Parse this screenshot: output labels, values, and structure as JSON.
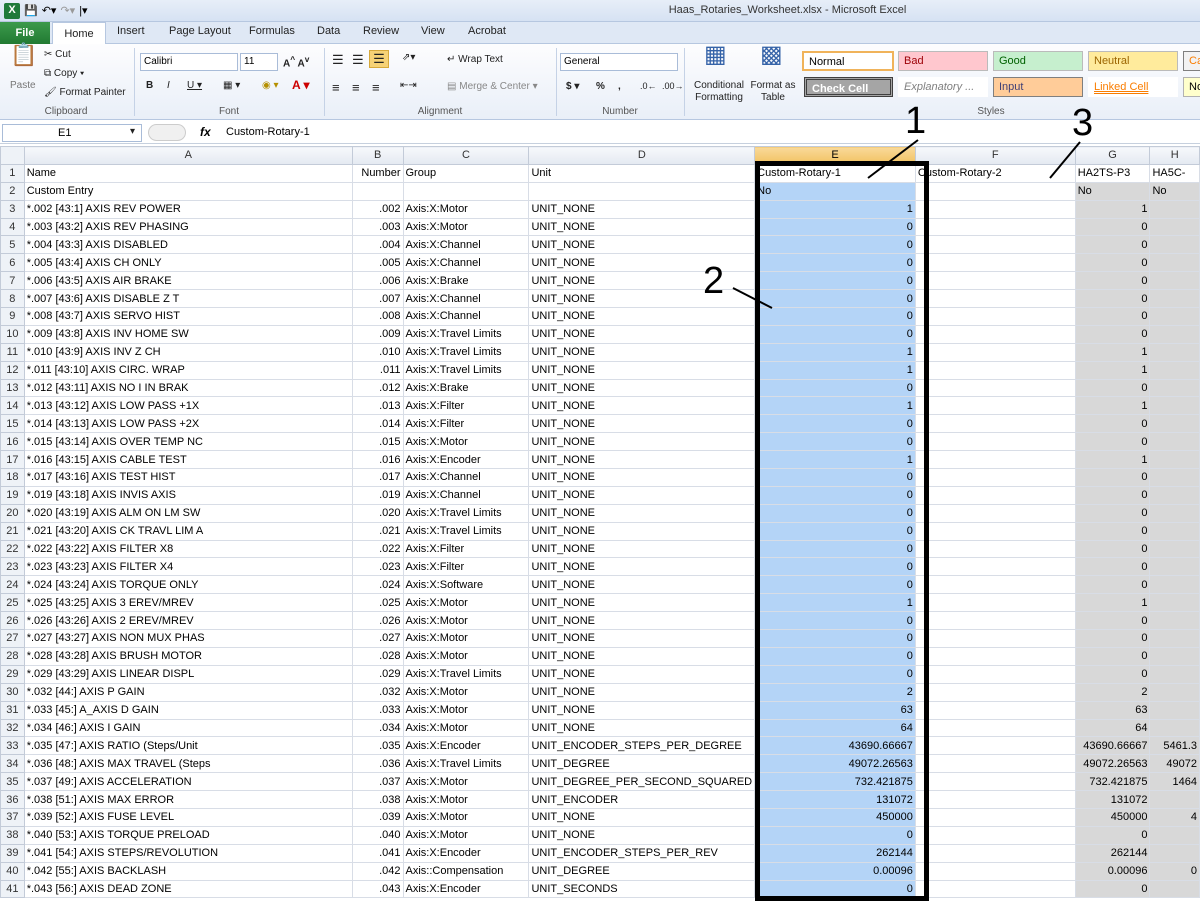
{
  "window": {
    "title": "Haas_Rotaries_Worksheet.xlsx - Microsoft Excel",
    "app_icon": "X"
  },
  "tabs": [
    "File",
    "Home",
    "Insert",
    "Page Layout",
    "Formulas",
    "Data",
    "Review",
    "View",
    "Acrobat"
  ],
  "ribbon": {
    "clipboard": {
      "paste": "Paste",
      "cut": "Cut",
      "copy": "Copy",
      "format_painter": "Format Painter",
      "label": "Clipboard"
    },
    "font": {
      "name": "Calibri",
      "size": "11",
      "label": "Font"
    },
    "alignment": {
      "wrap": "Wrap Text",
      "merge": "Merge & Center",
      "label": "Alignment"
    },
    "number": {
      "format": "General",
      "label": "Number"
    },
    "styles": {
      "conditional": "Conditional Formatting",
      "format_table": "Format as Table",
      "label": "Styles",
      "cells": [
        "Normal",
        "Bad",
        "Good",
        "Neutral",
        "Ca",
        "Check Cell",
        "Explanatory ...",
        "Input",
        "Linked Cell",
        "No"
      ]
    }
  },
  "formula_bar": {
    "cell": "E1",
    "content": "Custom-Rotary-1"
  },
  "columns": [
    "A",
    "B",
    "C",
    "D",
    "E",
    "F",
    "G",
    "H"
  ],
  "rows": [
    {
      "n": "1",
      "a": "Name",
      "b": "Number",
      "c": "Group",
      "d": "Unit",
      "e": "Custom-Rotary-1",
      "f": "Custom-Rotary-2",
      "g": "HA2TS-P3",
      "h": "HA5C-"
    },
    {
      "n": "2",
      "a": "Custom Entry",
      "b": "",
      "c": "",
      "d": "",
      "e": "No",
      "f": "",
      "g": "No",
      "h": "No"
    },
    {
      "n": "3",
      "a": "*.002 [43:1]  AXIS REV POWER",
      "b": ".002",
      "c": "Axis:X:Motor",
      "d": "UNIT_NONE",
      "e": "1",
      "f": "",
      "g": "1",
      "h": ""
    },
    {
      "n": "4",
      "a": "*.003 [43:2]  AXIS REV PHASING",
      "b": ".003",
      "c": "Axis:X:Motor",
      "d": "UNIT_NONE",
      "e": "0",
      "f": "",
      "g": "0",
      "h": ""
    },
    {
      "n": "5",
      "a": "*.004 [43:3]  AXIS DISABLED",
      "b": ".004",
      "c": "Axis:X:Channel",
      "d": "UNIT_NONE",
      "e": "0",
      "f": "",
      "g": "0",
      "h": ""
    },
    {
      "n": "6",
      "a": "*.005 [43:4]  AXIS CH ONLY",
      "b": ".005",
      "c": "Axis:X:Channel",
      "d": "UNIT_NONE",
      "e": "0",
      "f": "",
      "g": "0",
      "h": ""
    },
    {
      "n": "7",
      "a": "*.006 [43:5]  AXIS AIR BRAKE",
      "b": ".006",
      "c": "Axis:X:Brake",
      "d": "UNIT_NONE",
      "e": "0",
      "f": "",
      "g": "0",
      "h": ""
    },
    {
      "n": "8",
      "a": "*.007 [43:6]  AXIS DISABLE Z T",
      "b": ".007",
      "c": "Axis:X:Channel",
      "d": "UNIT_NONE",
      "e": "0",
      "f": "",
      "g": "0",
      "h": ""
    },
    {
      "n": "9",
      "a": "*.008 [43:7]  AXIS SERVO HIST",
      "b": ".008",
      "c": "Axis:X:Channel",
      "d": "UNIT_NONE",
      "e": "0",
      "f": "",
      "g": "0",
      "h": ""
    },
    {
      "n": "10",
      "a": "*.009 [43:8]  AXIS INV HOME SW",
      "b": ".009",
      "c": "Axis:X:Travel Limits",
      "d": "UNIT_NONE",
      "e": "0",
      "f": "",
      "g": "0",
      "h": ""
    },
    {
      "n": "11",
      "a": "*.010 [43:9]  AXIS INV Z CH",
      "b": ".010",
      "c": "Axis:X:Travel Limits",
      "d": "UNIT_NONE",
      "e": "1",
      "f": "",
      "g": "1",
      "h": ""
    },
    {
      "n": "12",
      "a": "*.011 [43:10]  AXIS CIRC. WRAP",
      "b": ".011",
      "c": "Axis:X:Travel Limits",
      "d": "UNIT_NONE",
      "e": "1",
      "f": "",
      "g": "1",
      "h": ""
    },
    {
      "n": "13",
      "a": "*.012 [43:11]  AXIS NO I IN BRAK",
      "b": ".012",
      "c": "Axis:X:Brake",
      "d": "UNIT_NONE",
      "e": "0",
      "f": "",
      "g": "0",
      "h": ""
    },
    {
      "n": "14",
      "a": "*.013 [43:12]  AXIS LOW PASS +1X",
      "b": ".013",
      "c": "Axis:X:Filter",
      "d": "UNIT_NONE",
      "e": "1",
      "f": "",
      "g": "1",
      "h": ""
    },
    {
      "n": "15",
      "a": "*.014 [43:13]  AXIS LOW PASS +2X",
      "b": ".014",
      "c": "Axis:X:Filter",
      "d": "UNIT_NONE",
      "e": "0",
      "f": "",
      "g": "0",
      "h": ""
    },
    {
      "n": "16",
      "a": "*.015 [43:14]  AXIS OVER TEMP NC",
      "b": ".015",
      "c": "Axis:X:Motor",
      "d": "UNIT_NONE",
      "e": "0",
      "f": "",
      "g": "0",
      "h": ""
    },
    {
      "n": "17",
      "a": "*.016 [43:15]  AXIS CABLE TEST",
      "b": ".016",
      "c": "Axis:X:Encoder",
      "d": "UNIT_NONE",
      "e": "1",
      "f": "",
      "g": "1",
      "h": ""
    },
    {
      "n": "18",
      "a": "*.017 [43:16]  AXIS TEST HIST",
      "b": ".017",
      "c": "Axis:X:Channel",
      "d": "UNIT_NONE",
      "e": "0",
      "f": "",
      "g": "0",
      "h": ""
    },
    {
      "n": "19",
      "a": "*.019 [43:18]  AXIS INVIS AXIS",
      "b": ".019",
      "c": "Axis:X:Channel",
      "d": "UNIT_NONE",
      "e": "0",
      "f": "",
      "g": "0",
      "h": ""
    },
    {
      "n": "20",
      "a": "*.020 [43:19]  AXIS ALM ON LM SW",
      "b": ".020",
      "c": "Axis:X:Travel Limits",
      "d": "UNIT_NONE",
      "e": "0",
      "f": "",
      "g": "0",
      "h": ""
    },
    {
      "n": "21",
      "a": "*.021 [43:20]  AXIS CK TRAVL LIM A",
      "b": ".021",
      "c": "Axis:X:Travel Limits",
      "d": "UNIT_NONE",
      "e": "0",
      "f": "",
      "g": "0",
      "h": ""
    },
    {
      "n": "22",
      "a": "*.022 [43:22]  AXIS FILTER X8",
      "b": ".022",
      "c": "Axis:X:Filter",
      "d": "UNIT_NONE",
      "e": "0",
      "f": "",
      "g": "0",
      "h": ""
    },
    {
      "n": "23",
      "a": "*.023 [43:23]  AXIS FILTER X4",
      "b": ".023",
      "c": "Axis:X:Filter",
      "d": "UNIT_NONE",
      "e": "0",
      "f": "",
      "g": "0",
      "h": ""
    },
    {
      "n": "24",
      "a": "*.024 [43:24]  AXIS TORQUE ONLY",
      "b": ".024",
      "c": "Axis:X:Software",
      "d": "UNIT_NONE",
      "e": "0",
      "f": "",
      "g": "0",
      "h": ""
    },
    {
      "n": "25",
      "a": "*.025 [43:25]  AXIS 3 EREV/MREV",
      "b": ".025",
      "c": "Axis:X:Motor",
      "d": "UNIT_NONE",
      "e": "1",
      "f": "",
      "g": "1",
      "h": ""
    },
    {
      "n": "26",
      "a": "*.026 [43:26]  AXIS 2 EREV/MREV",
      "b": ".026",
      "c": "Axis:X:Motor",
      "d": "UNIT_NONE",
      "e": "0",
      "f": "",
      "g": "0",
      "h": ""
    },
    {
      "n": "27",
      "a": "*.027 [43:27]  AXIS NON MUX PHAS",
      "b": ".027",
      "c": "Axis:X:Motor",
      "d": "UNIT_NONE",
      "e": "0",
      "f": "",
      "g": "0",
      "h": ""
    },
    {
      "n": "28",
      "a": "*.028 [43:28]  AXIS BRUSH MOTOR",
      "b": ".028",
      "c": "Axis:X:Motor",
      "d": "UNIT_NONE",
      "e": "0",
      "f": "",
      "g": "0",
      "h": ""
    },
    {
      "n": "29",
      "a": "*.029 [43:29]  AXIS LINEAR DISPL",
      "b": ".029",
      "c": "Axis:X:Travel Limits",
      "d": "UNIT_NONE",
      "e": "0",
      "f": "",
      "g": "0",
      "h": ""
    },
    {
      "n": "30",
      "a": "*.032 [44:]  AXIS P GAIN",
      "b": ".032",
      "c": "Axis:X:Motor",
      "d": "UNIT_NONE",
      "e": "2",
      "f": "",
      "g": "2",
      "h": ""
    },
    {
      "n": "31",
      "a": "*.033 [45:]  A_AXIS D GAIN",
      "b": ".033",
      "c": "Axis:X:Motor",
      "d": "UNIT_NONE",
      "e": "63",
      "f": "",
      "g": "63",
      "h": ""
    },
    {
      "n": "32",
      "a": "*.034 [46:]  AXIS I GAIN",
      "b": ".034",
      "c": "Axis:X:Motor",
      "d": "UNIT_NONE",
      "e": "64",
      "f": "",
      "g": "64",
      "h": ""
    },
    {
      "n": "33",
      "a": "*.035 [47:]  AXIS RATIO (Steps/Unit",
      "b": ".035",
      "c": "Axis:X:Encoder",
      "d": "UNIT_ENCODER_STEPS_PER_DEGREE",
      "e": "43690.66667",
      "f": "",
      "g": "43690.66667",
      "h": "5461.3"
    },
    {
      "n": "34",
      "a": "*.036 [48:]  AXIS MAX TRAVEL (Steps",
      "b": ".036",
      "c": "Axis:X:Travel Limits",
      "d": "UNIT_DEGREE",
      "e": "49072.26563",
      "f": "",
      "g": "49072.26563",
      "h": "49072"
    },
    {
      "n": "35",
      "a": "*.037 [49:]  AXIS ACCELERATION",
      "b": ".037",
      "c": "Axis:X:Motor",
      "d": "UNIT_DEGREE_PER_SECOND_SQUARED",
      "e": "732.421875",
      "f": "",
      "g": "732.421875",
      "h": "1464"
    },
    {
      "n": "36",
      "a": "*.038 [51:]  AXIS MAX ERROR",
      "b": ".038",
      "c": "Axis:X:Motor",
      "d": "UNIT_ENCODER",
      "e": "131072",
      "f": "",
      "g": "131072",
      "h": ""
    },
    {
      "n": "37",
      "a": "*.039 [52:]  AXIS FUSE LEVEL",
      "b": ".039",
      "c": "Axis:X:Motor",
      "d": "UNIT_NONE",
      "e": "450000",
      "f": "",
      "g": "450000",
      "h": "4"
    },
    {
      "n": "38",
      "a": "*.040 [53:]  AXIS TORQUE PRELOAD",
      "b": ".040",
      "c": "Axis:X:Motor",
      "d": "UNIT_NONE",
      "e": "0",
      "f": "",
      "g": "0",
      "h": ""
    },
    {
      "n": "39",
      "a": "*.041 [54:]  AXIS STEPS/REVOLUTION",
      "b": ".041",
      "c": "Axis:X:Encoder",
      "d": "UNIT_ENCODER_STEPS_PER_REV",
      "e": "262144",
      "f": "",
      "g": "262144",
      "h": ""
    },
    {
      "n": "40",
      "a": "*.042 [55:]  AXIS BACKLASH",
      "b": ".042",
      "c": "Axis::Compensation",
      "d": "UNIT_DEGREE",
      "e": "0.00096",
      "f": "",
      "g": "0.00096",
      "h": "0"
    },
    {
      "n": "41",
      "a": "*.043 [56:]  AXIS DEAD ZONE",
      "b": ".043",
      "c": "Axis:X:Encoder",
      "d": "UNIT_SECONDS",
      "e": "0",
      "f": "",
      "g": "0",
      "h": ""
    }
  ],
  "callouts": [
    "1",
    "2",
    "3"
  ]
}
